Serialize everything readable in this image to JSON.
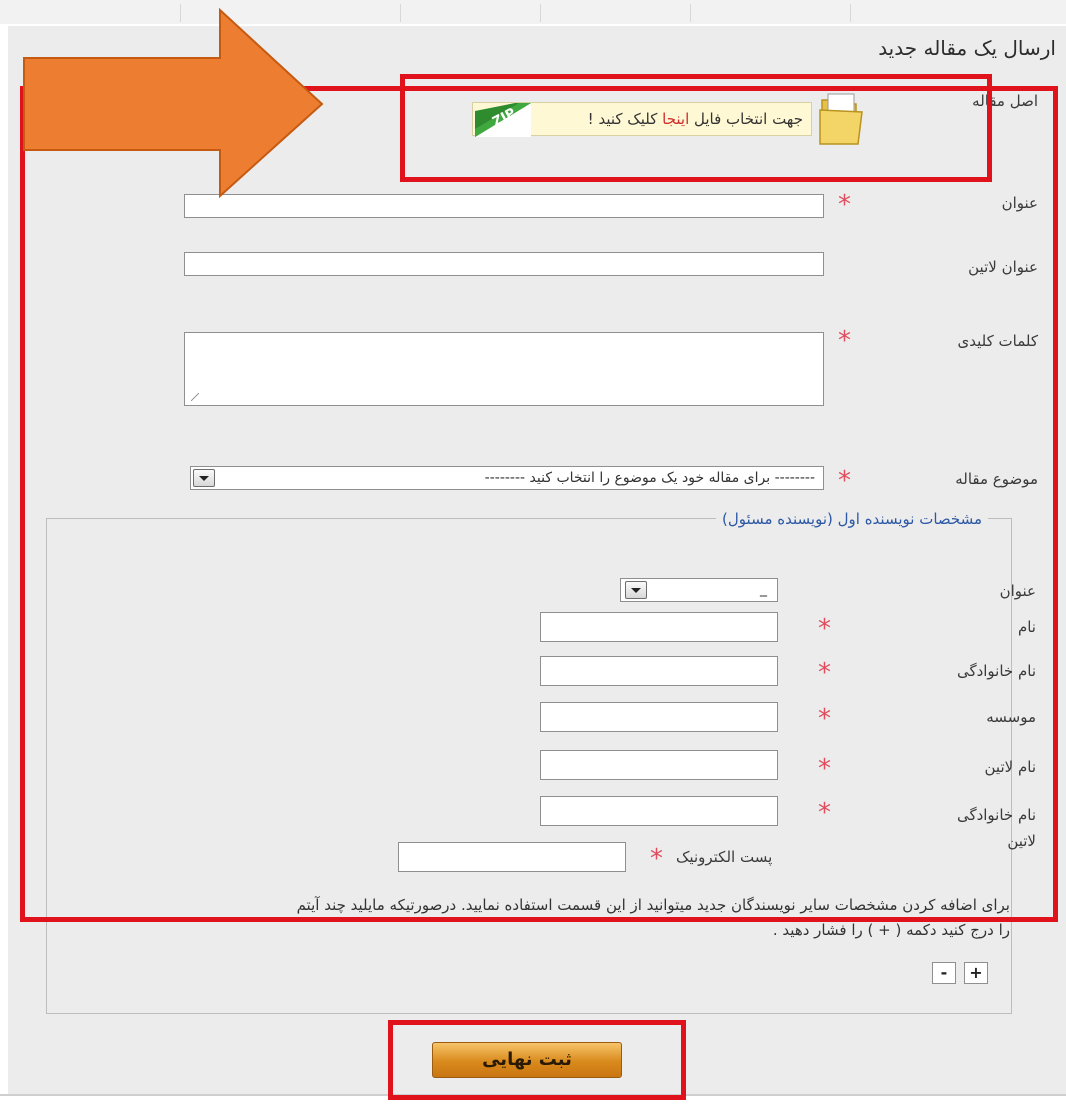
{
  "page": {
    "title": "ارسال یک مقاله جدید"
  },
  "upload": {
    "label": "اصل مقاله",
    "text_before": "جهت انتخاب فایل ",
    "text_link": "اینجا",
    "text_after": " کلیک کنید !",
    "zip_badge": "ZIP"
  },
  "form": {
    "title_label": "عنوان",
    "title_value": "",
    "latin_title_label": "عنوان لاتین",
    "latin_title_value": "",
    "keywords_label": "کلمات کلیدی",
    "keywords_value": "",
    "subject_label": "موضوع مقاله",
    "subject_selected": "-------- برای مقاله خود یک موضوع را انتخاب کنید --------",
    "required_marker": "*"
  },
  "author": {
    "legend": "مشخصات نویسنده اول (نویسنده مسئول)",
    "honorific_label": "عنوان",
    "honorific_selected": "_",
    "first_name_label": "نام",
    "last_name_label": "نام خانوادگی",
    "institution_label": "موسسه",
    "latin_name_label": "نام لاتین",
    "latin_last_name_label": "نام خانوادگی لاتین",
    "email_label": "پست الکترونیک"
  },
  "add_authors_note_line1": "برای اضافه کردن مشخصات سایر نویسندگان جدید میتوانید از این قسمت استفاده نمایید. درصورتیکه مایلید چند آیتم",
  "add_authors_note_line2": "را درج کنید دکمه ( + ) را فشار دهید .",
  "buttons": {
    "add": "+",
    "remove": "-",
    "submit": "ثبت نهایی"
  },
  "colors": {
    "annotation_arrow": "#ed7d31",
    "annotation_box": "#e0121c",
    "required_star": "#e24d5e",
    "legend_text": "#2c58a6"
  }
}
